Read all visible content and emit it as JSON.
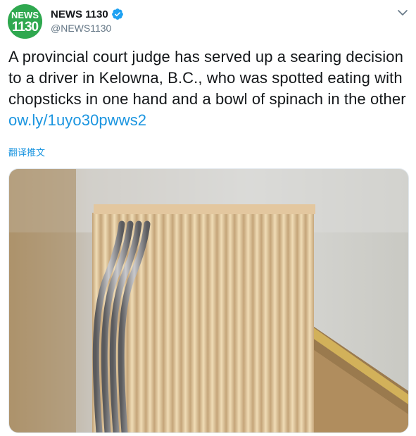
{
  "account": {
    "display_name": "NEWS 1130",
    "handle": "@NEWS1130",
    "verified": true,
    "avatar_icon": "news1130-logo",
    "avatar_logo_text_top": "NEWS",
    "avatar_logo_text_bottom": "1130",
    "avatar_color": "#2fa84f"
  },
  "menu": {
    "icon": "chevron-down-icon"
  },
  "tweet": {
    "text": "A provincial court judge has served up a searing decision to a driver in Kelowna, B.C., who was spotted eating with chopsticks in one hand and a bowl of spinach in the other ",
    "link_text": "ow.ly/1uyo30pwws2",
    "translate_label": "翻译推文"
  },
  "media": {
    "description_icon": "chopsticks-and-forks-photo"
  },
  "colors": {
    "link": "#1b95e0",
    "text": "#14171a",
    "secondary": "#657786",
    "verified": "#1da1f2"
  }
}
